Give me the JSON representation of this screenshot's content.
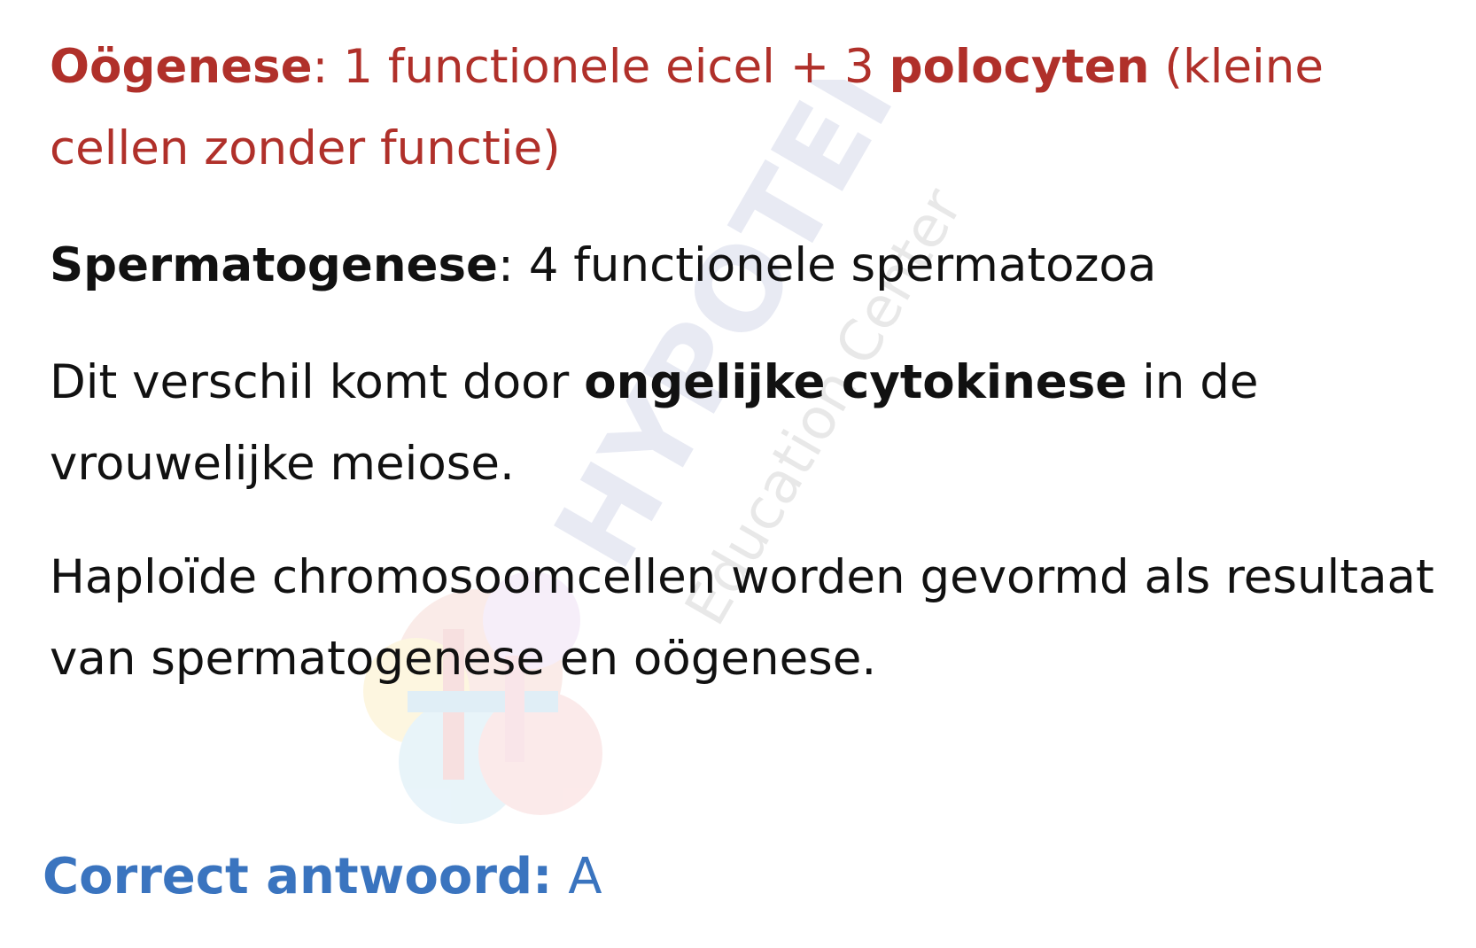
{
  "paragraph1": {
    "term": "Oögenese",
    "sep": ":",
    "text_a": " 1 functionele eicel + 3 ",
    "bold": "polocyten",
    "text_b": " (kleine cellen zonder functie)",
    "color": "#b0302a"
  },
  "paragraph2": {
    "term": "Spermatogenese",
    "text": ": 4 functionele spermatozoa"
  },
  "paragraph3": {
    "text_a": "Dit verschil komt door ",
    "bold": "ongelijke cytokinese",
    "text_b": " in de vrouwelijke meiose."
  },
  "paragraph4": {
    "text": "Haploïde chromosoomcellen worden gevormd als resultaat van spermatogenese en oögenese."
  },
  "answer": {
    "label": "Correct antwoord:",
    "value": " A",
    "color": "#3a74bf"
  },
  "watermark": {
    "brand": "HYPOTENUSE",
    "subtitle": "Education Center"
  }
}
